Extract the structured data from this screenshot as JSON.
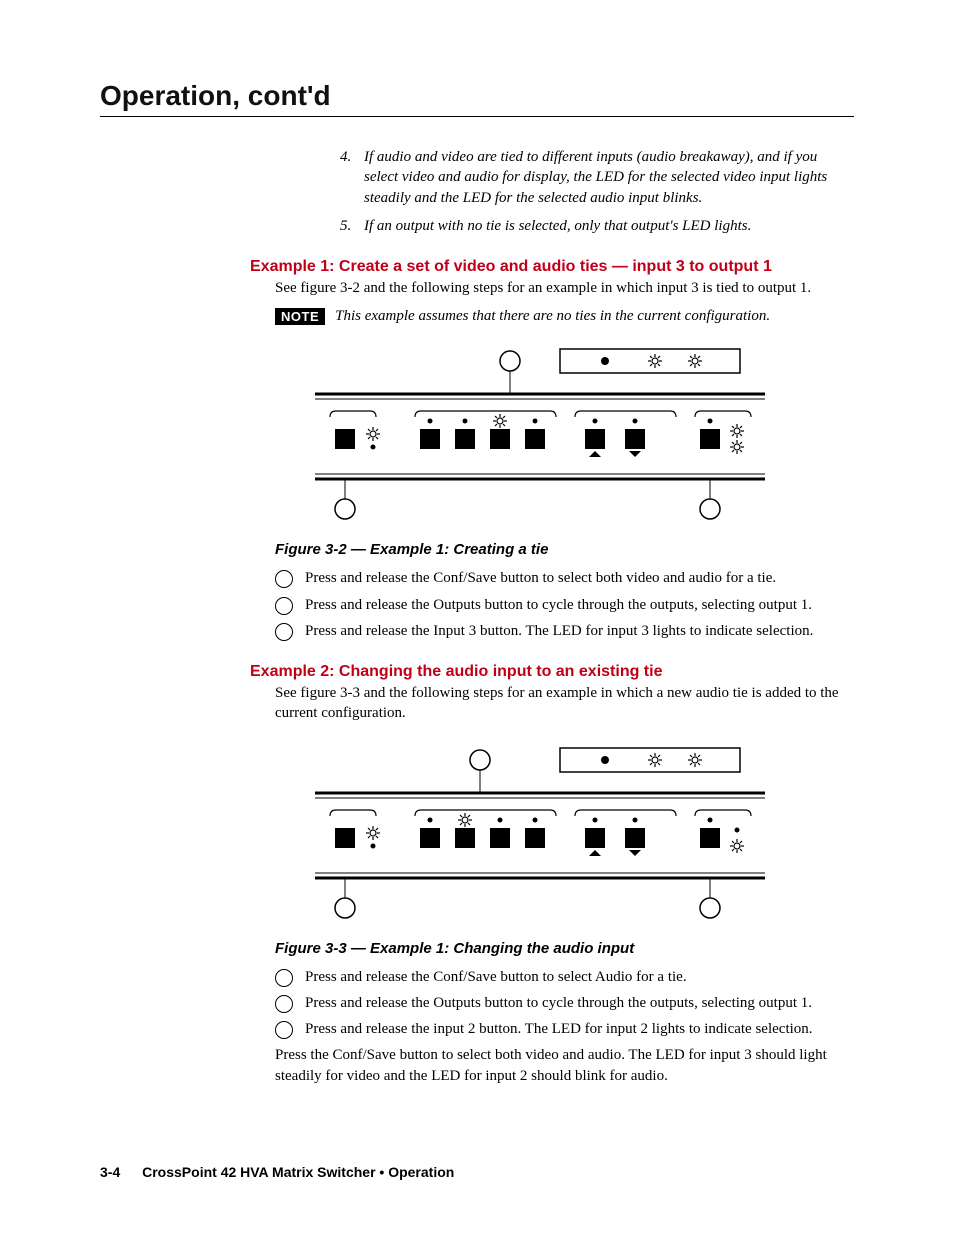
{
  "header": {
    "title": "Operation, cont'd"
  },
  "notes_list": {
    "item4": {
      "num": "4.",
      "text": "If audio and video are tied to different inputs (audio breakaway), and if you select video and audio for display, the LED for the selected video input lights steadily and the LED for the selected audio input blinks."
    },
    "item5": {
      "num": "5.",
      "text": "If an output with no tie is selected, only that output's LED lights."
    }
  },
  "example1": {
    "heading": "Example 1:  Create a set of video and audio ties — input 3 to output 1",
    "intro": "See figure 3-2 and the following steps for an example in which input 3 is tied to output 1.",
    "note_label": "NOTE",
    "note_text": "This example assumes that there are no ties in the current configuration.",
    "caption": "Figure 3-2 — Example 1:  Creating a tie",
    "steps": {
      "s1": "Press and release the Conf/Save button to select both video and audio for a tie.",
      "s2": "Press and release the Outputs button to cycle through the outputs, selecting output 1.",
      "s3": "Press and release the Input 3 button. The LED for input 3 lights to indicate selection."
    }
  },
  "example2": {
    "heading": "Example 2:  Changing the audio input to an existing tie",
    "intro": "See figure 3-3 and the following steps for an example in which a new audio tie is added to the current configuration.",
    "caption": "Figure 3-3 — Example 1:  Changing the audio input",
    "steps": {
      "s1": "Press and release the Conf/Save button to select Audio for a tie.",
      "s2": "Press and release the Outputs button to cycle through the outputs, selecting output 1.",
      "s3": "Press and release the input 2 button. The LED for input 2 lights to indicate selection."
    },
    "closing": "Press the Conf/Save button to select both video and audio. The LED for input 3 should light steadily for video and the LED for input 2 should blink for audio."
  },
  "footer": {
    "page": "3-4",
    "title": "CrossPoint 42 HVA Matrix Switcher • Operation"
  }
}
